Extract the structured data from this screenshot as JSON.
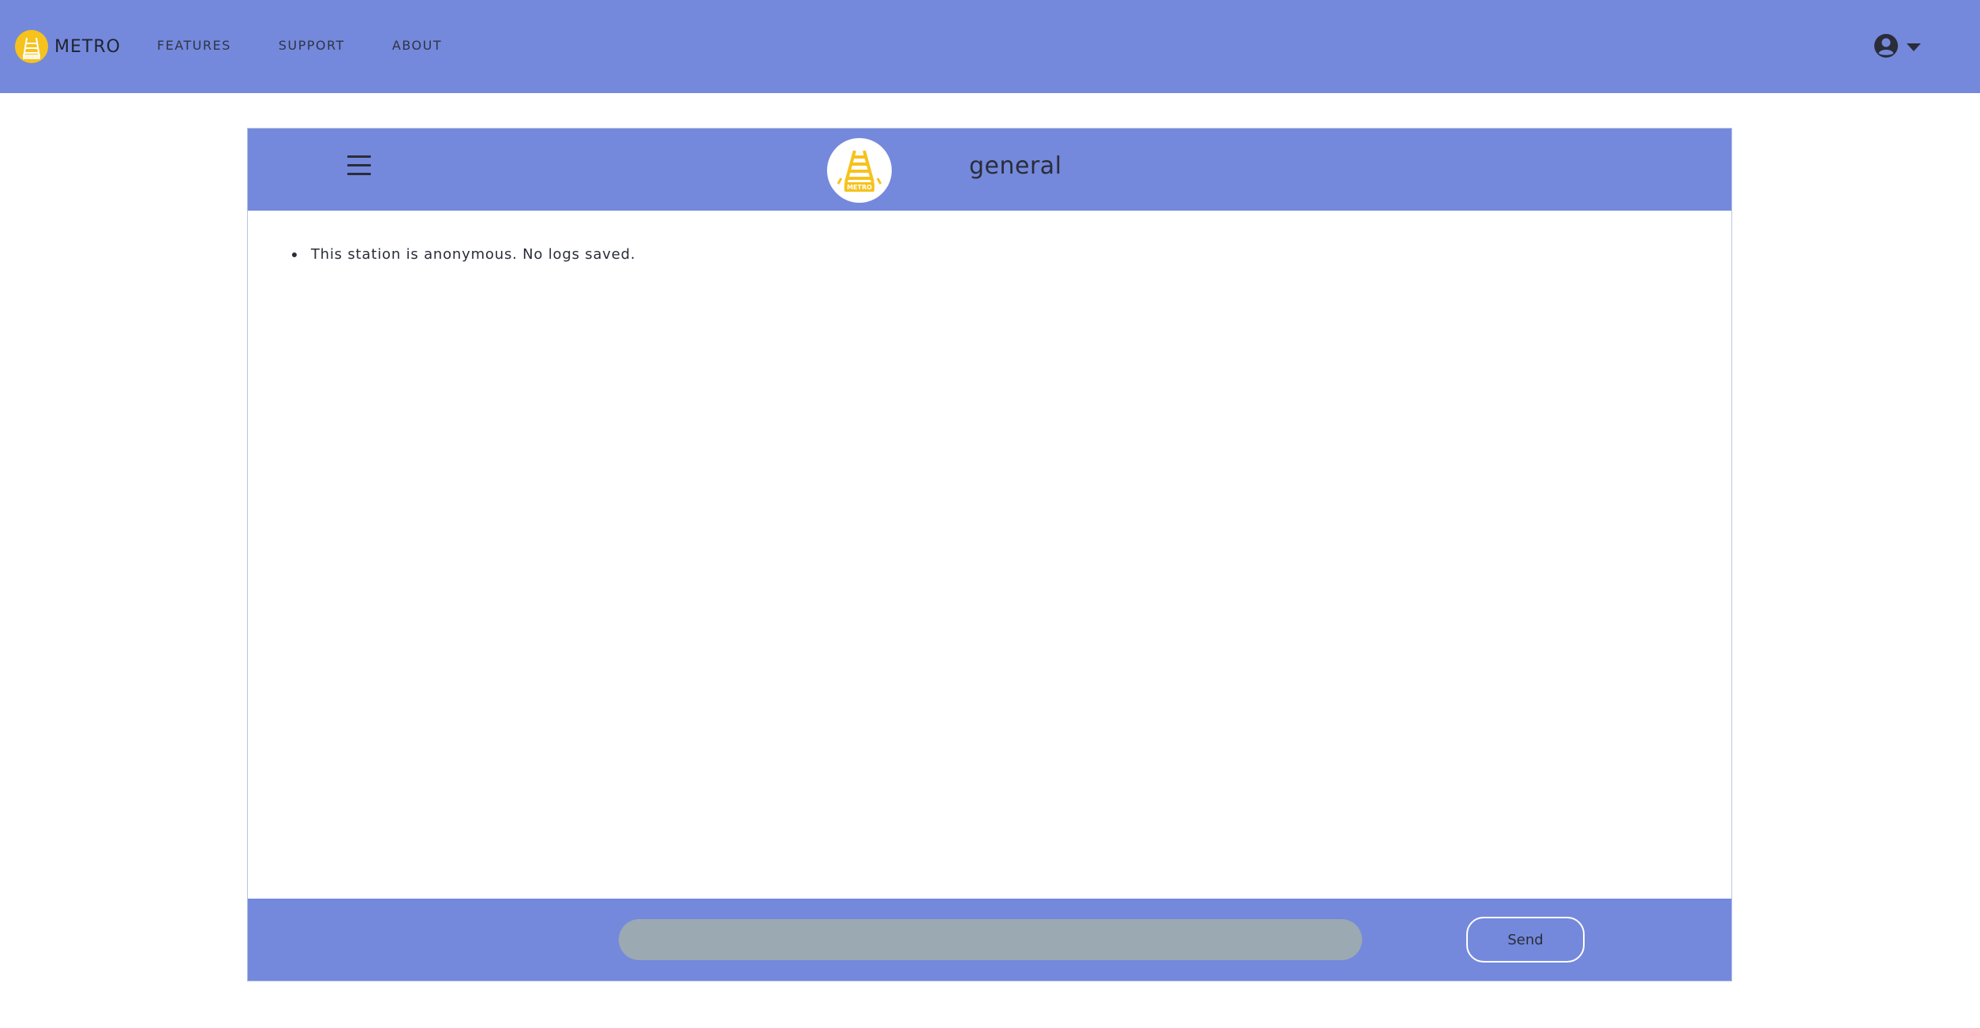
{
  "navbar": {
    "brand_name": "METRO",
    "links": [
      {
        "label": "FEATURES"
      },
      {
        "label": "SUPPORT"
      },
      {
        "label": "ABOUT"
      }
    ],
    "user_icon": "user-circle-icon"
  },
  "chat": {
    "station_name": "general",
    "logo_text": "METRO",
    "messages": [
      {
        "text": "This station is anonymous. No logs saved."
      }
    ],
    "input": {
      "value": "",
      "placeholder": ""
    },
    "send_label": "Send"
  },
  "colors": {
    "primary": "#7489dc",
    "accent": "#f6c21c",
    "input_bg": "#9ba9b3",
    "text": "#2a2d38"
  }
}
